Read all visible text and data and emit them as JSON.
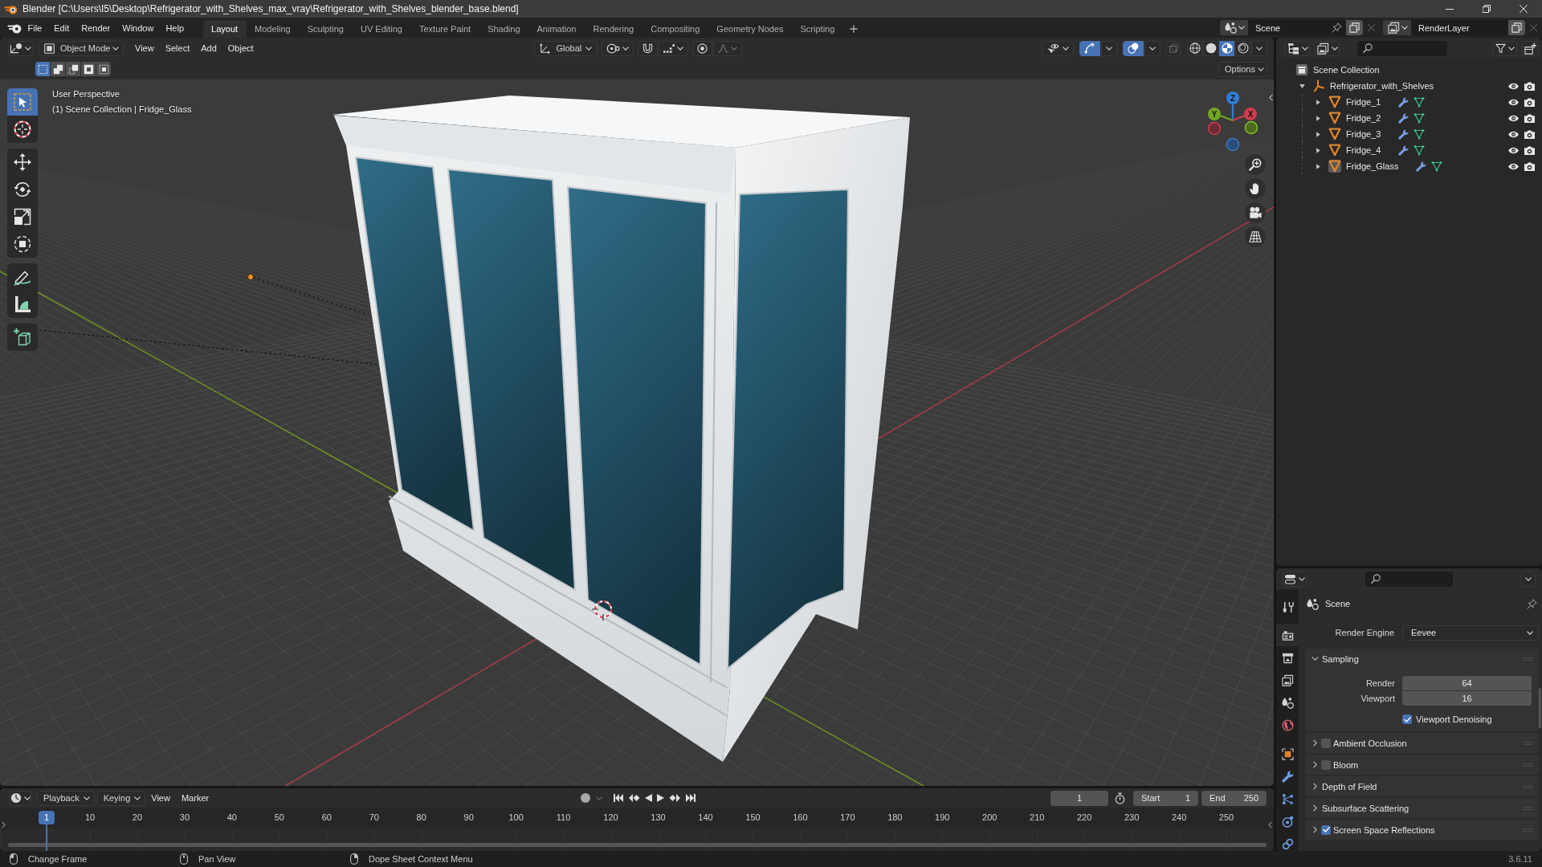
{
  "window": {
    "title": "Blender [C:\\Users\\I5\\Desktop\\Refrigerator_with_Shelves_max_vray\\Refrigerator_with_Shelves_blender_base.blend]"
  },
  "top_bar": {
    "menus": [
      "File",
      "Edit",
      "Render",
      "Window",
      "Help"
    ],
    "workspaces": [
      {
        "label": "Layout",
        "selected": true
      },
      {
        "label": "Modeling",
        "selected": false
      },
      {
        "label": "Sculpting",
        "selected": false
      },
      {
        "label": "UV Editing",
        "selected": false
      },
      {
        "label": "Texture Paint",
        "selected": false
      },
      {
        "label": "Shading",
        "selected": false
      },
      {
        "label": "Animation",
        "selected": false
      },
      {
        "label": "Rendering",
        "selected": false
      },
      {
        "label": "Compositing",
        "selected": false
      },
      {
        "label": "Geometry Nodes",
        "selected": false
      },
      {
        "label": "Scripting",
        "selected": false
      }
    ],
    "scene": "Scene",
    "view_layer": "RenderLayer"
  },
  "viewport": {
    "mode": "Object Mode",
    "menus": [
      "View",
      "Select",
      "Add",
      "Object"
    ],
    "orientation": "Global",
    "snapping": false,
    "proportional_editing": false,
    "gizmos": true,
    "overlays": true,
    "xray": false,
    "shading": [
      {
        "selected": false
      },
      {
        "selected": false
      },
      {
        "selected": true
      },
      {
        "selected": false
      }
    ],
    "select_modes": [
      {
        "selected": true
      },
      {
        "selected": false
      },
      {
        "selected": false
      },
      {
        "selected": false
      },
      {
        "selected": false
      }
    ],
    "options": "Options",
    "tools": [
      {
        "selected": true
      },
      {
        "selected": false
      },
      {
        "selected": false
      },
      {
        "selected": false
      },
      {
        "selected": false
      },
      {
        "selected": false
      },
      {
        "selected": false
      },
      {
        "selected": false
      },
      {
        "selected": false
      }
    ],
    "view_name": "User Perspective",
    "context": "(1) Scene Collection | Fridge_Glass",
    "axes": [
      "Z",
      "Y",
      "X"
    ]
  },
  "outliner": {
    "root": "Scene Collection",
    "items": [
      {
        "label": "Refrigerator_with_Shelves",
        "kind": "empty",
        "expanded": true,
        "active": false,
        "children": [
          {
            "label": "Fridge_1",
            "kind": "mesh",
            "expanded": false,
            "active": false
          },
          {
            "label": "Fridge_2",
            "kind": "mesh",
            "expanded": false,
            "active": false
          },
          {
            "label": "Fridge_3",
            "kind": "mesh",
            "expanded": false,
            "active": false
          },
          {
            "label": "Fridge_4",
            "kind": "mesh",
            "expanded": false,
            "active": false
          },
          {
            "label": "Fridge_Glass",
            "kind": "mesh",
            "expanded": false,
            "active": true
          }
        ]
      }
    ]
  },
  "properties": {
    "tabs": [
      {
        "selected": false
      },
      {
        "selected": true
      },
      {
        "selected": false
      },
      {
        "selected": false
      },
      {
        "selected": false
      },
      {
        "selected": false
      },
      {
        "selected": false
      },
      {
        "selected": false
      },
      {
        "selected": false
      },
      {
        "selected": false
      },
      {
        "selected": false
      }
    ],
    "context": "Scene",
    "render_engine": {
      "label": "Render Engine",
      "value": "Eevee"
    },
    "panels": [
      {
        "title": "Sampling",
        "kind": "plain",
        "expanded": true,
        "fields": [
          {
            "label": "Render",
            "value": "64"
          },
          {
            "label": "Viewport",
            "value": "16"
          }
        ],
        "options": [
          {
            "label": "Viewport Denoising",
            "checked": true
          }
        ]
      },
      {
        "title": "Ambient Occlusion",
        "kind": "toggle",
        "checked": false,
        "expanded": false
      },
      {
        "title": "Bloom",
        "kind": "toggle",
        "checked": false,
        "expanded": false
      },
      {
        "title": "Depth of Field",
        "kind": "plain",
        "expanded": false
      },
      {
        "title": "Subsurface Scattering",
        "kind": "plain",
        "expanded": false
      },
      {
        "title": "Screen Space Reflections",
        "kind": "toggle",
        "checked": true,
        "expanded": false
      }
    ]
  },
  "timeline": {
    "menus": [
      {
        "label": "Playback",
        "kind": "dropdown"
      },
      {
        "label": "Keying",
        "kind": "dropdown"
      },
      {
        "label": "View",
        "kind": "menu"
      },
      {
        "label": "Marker",
        "kind": "menu"
      }
    ],
    "current_frame": "1",
    "start": {
      "label": "Start",
      "value": "1"
    },
    "end": {
      "label": "End",
      "value": "250"
    },
    "playhead": "1",
    "frames": [
      "10",
      "20",
      "30",
      "40",
      "50",
      "60",
      "70",
      "80",
      "90",
      "100",
      "110",
      "120",
      "130",
      "140",
      "150",
      "160",
      "170",
      "180",
      "190",
      "200",
      "210",
      "220",
      "230",
      "240",
      "250"
    ]
  },
  "status_bar": {
    "hints": [
      "Change Frame",
      "Pan View",
      "Dope Sheet Context Menu"
    ],
    "version": "3.6.11"
  }
}
